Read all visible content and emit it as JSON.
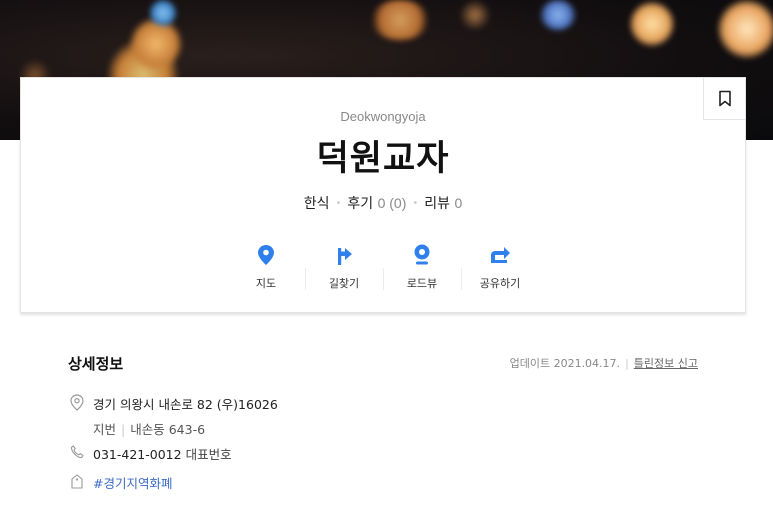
{
  "place": {
    "name_en": "Deokwongyoja",
    "name": "덕원교자",
    "category": "한식",
    "reviews_label": "후기",
    "reviews_count": "0 (0)",
    "blog_reviews_label": "리뷰",
    "blog_reviews_count": "0"
  },
  "actions": [
    {
      "label": "지도",
      "icon": "map-pin-icon"
    },
    {
      "label": "길찾기",
      "icon": "directions-icon"
    },
    {
      "label": "로드뷰",
      "icon": "roadview-icon"
    },
    {
      "label": "공유하기",
      "icon": "share-icon"
    }
  ],
  "detail": {
    "title": "상세정보",
    "update_text": "업데이트 2021.04.17.",
    "report_link": "틀린정보 신고",
    "address": "경기 의왕시 내손로 82 (우)16026",
    "lot_label": "지번",
    "lot_address": "내손동 643-6",
    "phone": "031-421-0012",
    "phone_label": "대표번호",
    "tag": "#경기지역화폐"
  },
  "colors": {
    "accent": "#2f80ed",
    "link": "#3c6ac7"
  }
}
